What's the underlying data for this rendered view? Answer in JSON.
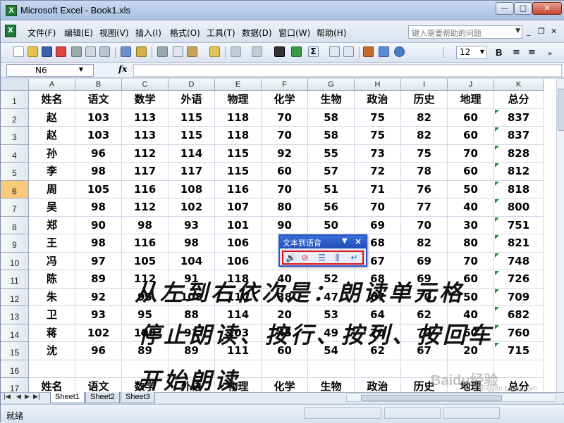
{
  "app": {
    "title": "Microsoft Excel - Book1.xls",
    "icon_text": "X"
  },
  "window_controls": {
    "minimize": "—",
    "maximize": "□",
    "close": "✕"
  },
  "menubar": {
    "items": [
      "文件(F)",
      "编辑(E)",
      "视图(V)",
      "插入(I)",
      "格式(O)",
      "工具(T)",
      "数据(D)",
      "窗口(W)",
      "帮助(H)"
    ],
    "help_placeholder": "键入需要帮助的问题"
  },
  "toolbar": {
    "font_size": "12",
    "bold": "B"
  },
  "formula_bar": {
    "name_box": "N6",
    "fx": "fx",
    "value": ""
  },
  "sheet": {
    "columns": [
      "A",
      "B",
      "C",
      "D",
      "E",
      "F",
      "G",
      "H",
      "I",
      "J",
      "K"
    ],
    "active_row": 6,
    "rows": [
      {
        "n": "1",
        "cells": [
          "姓名",
          "语文",
          "数学",
          "外语",
          "物理",
          "化学",
          "生物",
          "政治",
          "历史",
          "地理",
          "总分"
        ]
      },
      {
        "n": "2",
        "cells": [
          "赵",
          "103",
          "113",
          "115",
          "118",
          "70",
          "58",
          "75",
          "82",
          "60",
          "837"
        ]
      },
      {
        "n": "3",
        "cells": [
          "赵",
          "103",
          "113",
          "115",
          "118",
          "70",
          "58",
          "75",
          "82",
          "60",
          "837"
        ]
      },
      {
        "n": "4",
        "cells": [
          "孙",
          "96",
          "112",
          "114",
          "115",
          "92",
          "55",
          "73",
          "75",
          "70",
          "828"
        ]
      },
      {
        "n": "5",
        "cells": [
          "李",
          "98",
          "117",
          "117",
          "115",
          "60",
          "57",
          "72",
          "78",
          "60",
          "812"
        ]
      },
      {
        "n": "6",
        "cells": [
          "周",
          "105",
          "116",
          "108",
          "116",
          "70",
          "51",
          "71",
          "76",
          "50",
          "818"
        ]
      },
      {
        "n": "7",
        "cells": [
          "吴",
          "98",
          "112",
          "102",
          "107",
          "80",
          "56",
          "70",
          "77",
          "40",
          "800"
        ]
      },
      {
        "n": "8",
        "cells": [
          "郑",
          "90",
          "98",
          "93",
          "101",
          "90",
          "50",
          "69",
          "70",
          "30",
          "751"
        ]
      },
      {
        "n": "9",
        "cells": [
          "王",
          "98",
          "116",
          "98",
          "106",
          "",
          "",
          "68",
          "82",
          "80",
          "821"
        ]
      },
      {
        "n": "10",
        "cells": [
          "冯",
          "97",
          "105",
          "104",
          "106",
          "",
          "",
          "67",
          "69",
          "70",
          "748"
        ]
      },
      {
        "n": "11",
        "cells": [
          "陈",
          "89",
          "112",
          "91",
          "118",
          "40",
          "52",
          "68",
          "69",
          "60",
          "726"
        ]
      },
      {
        "n": "12",
        "cells": [
          "朱",
          "92",
          "95",
          "108",
          "110",
          "38",
          "47",
          "67",
          "70",
          "50",
          "709"
        ]
      },
      {
        "n": "13",
        "cells": [
          "卫",
          "93",
          "95",
          "88",
          "114",
          "20",
          "53",
          "64",
          "62",
          "40",
          "682"
        ]
      },
      {
        "n": "14",
        "cells": [
          "蒋",
          "102",
          "100",
          "91",
          "103",
          "45",
          "49",
          "70",
          "70",
          "60",
          "760"
        ]
      },
      {
        "n": "15",
        "cells": [
          "沈",
          "96",
          "89",
          "89",
          "111",
          "60",
          "54",
          "62",
          "67",
          "20",
          "715"
        ]
      },
      {
        "n": "16",
        "cells": [
          "",
          "",
          "",
          "",
          "",
          "",
          "",
          "",
          "",
          "",
          ""
        ]
      },
      {
        "n": "17",
        "cells": [
          "姓名",
          "语文",
          "数学",
          "外语",
          "物理",
          "化学",
          "生物",
          "政治",
          "历史",
          "地理",
          "总分"
        ]
      }
    ]
  },
  "sheet_tabs": [
    "Sheet1",
    "Sheet2",
    "Sheet3"
  ],
  "tab_nav": [
    "|◀",
    "◀",
    "▶",
    "▶|"
  ],
  "status": {
    "text": "就绪"
  },
  "tts_toolbar": {
    "title": "文本到语音",
    "buttons": [
      "speak-cells",
      "stop-speaking",
      "by-rows",
      "by-columns",
      "speak-on-enter"
    ]
  },
  "annotation": {
    "line1": "从左到右依次是：朗读单元格",
    "line2": "停止朗读、按行、按列、按回车",
    "line3": "开始朗读"
  },
  "watermark": {
    "text": "Baidu经验",
    "url_text": "jingyan.baidu.com"
  }
}
